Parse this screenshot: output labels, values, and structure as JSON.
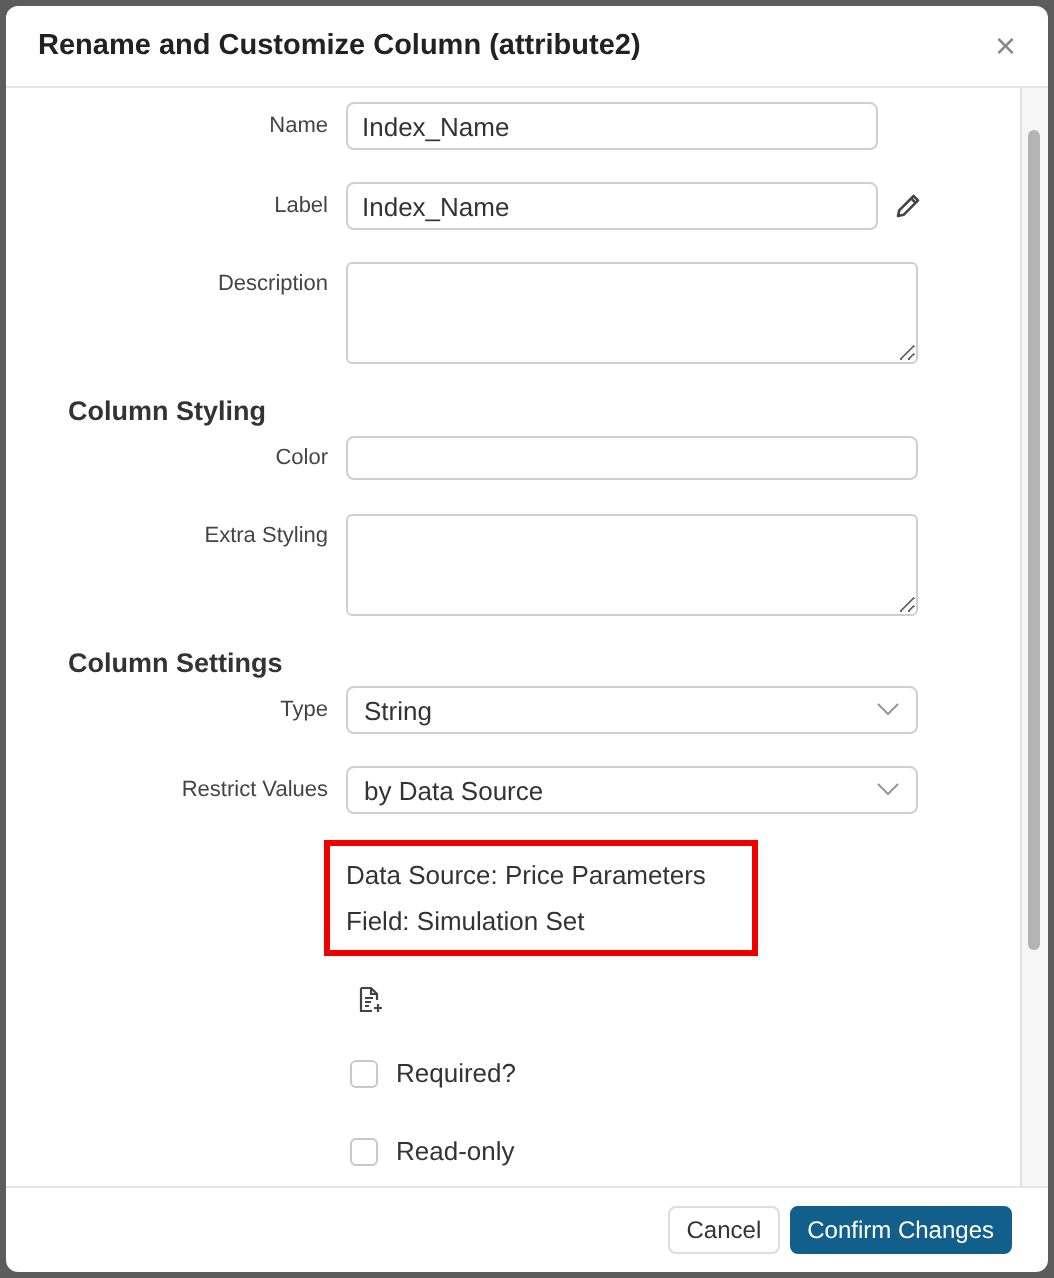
{
  "dialog": {
    "title": "Rename and Customize Column (attribute2)",
    "close": "×"
  },
  "rows": [
    {
      "kind": "input",
      "label": "Name",
      "value": "Index_Name"
    },
    {
      "kind": "edit_input",
      "label": "Label",
      "value": "Index_Name"
    },
    {
      "kind": "textarea",
      "label": "Description",
      "value": ""
    },
    {
      "kind": "heading",
      "text": "Column Styling"
    },
    {
      "kind": "wide_input",
      "label": "Color",
      "value": ""
    },
    {
      "kind": "textarea",
      "label": "Extra Styling",
      "value": ""
    },
    {
      "kind": "heading",
      "text": "Column Settings"
    },
    {
      "kind": "select",
      "label": "Type",
      "value": "String"
    },
    {
      "kind": "select",
      "label": "Restrict Values",
      "value": "by Data Source"
    },
    {
      "kind": "info",
      "lines": [
        "Data Source: Price Parameters",
        "Field: Simulation Set"
      ]
    },
    {
      "kind": "doc_icon"
    },
    {
      "kind": "checkbox",
      "label": "Required?",
      "checked": false
    },
    {
      "kind": "checkbox",
      "label": "Read-only",
      "checked": false
    }
  ],
  "buttons": [
    {
      "label": "Cancel",
      "kind": "secondary"
    },
    {
      "label": "Confirm Changes",
      "kind": "primary"
    }
  ]
}
